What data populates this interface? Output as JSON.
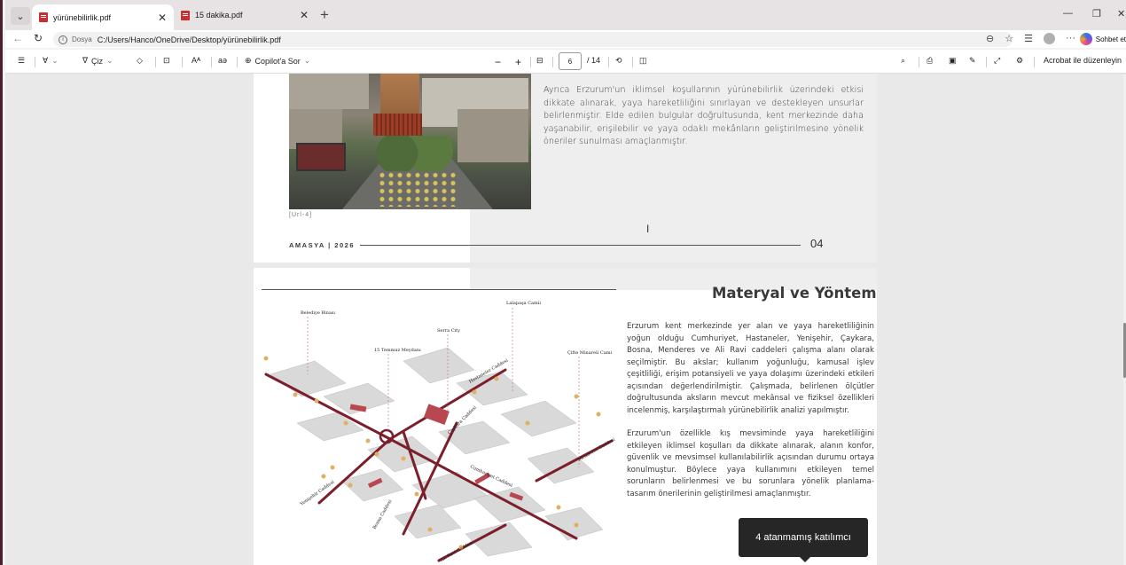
{
  "tabs": [
    {
      "title": "yürünebilirlik.pdf",
      "active": true
    },
    {
      "title": "15 dakika.pdf",
      "active": false
    }
  ],
  "address": {
    "protocol_label": "Dosya",
    "url": "C:/Users/Hanco/OneDrive/Desktop/yürünebilirlik.pdf",
    "copilot_label": "Sohbet et"
  },
  "pdf_toolbar": {
    "draw_label": "Çiz",
    "copilot_label": "Copilot'a Sor",
    "current_page": "6",
    "total_pages": "/ 14",
    "acrobat_label": "Acrobat ile düzenleyin"
  },
  "page1": {
    "body": "Ayrıca Erzurum'un iklimsel koşullarının yürünebilirlik üzerindeki etkisi dikkate alınarak, yaya hareketliliğini sınırlayan ve destekleyen unsurlar belirlenmiştir. Elde edilen bulgular doğrultusunda, kent merkezinde daha yaşanabilir, erişilebilir ve yaya odaklı mekânların geliştirilmesine yönelik öneriler sunulması amaçlanmıştır.",
    "caption": "[Url-4]",
    "footer_left": "AMASYA | 2026",
    "footer_num": "04"
  },
  "page2": {
    "title": "Materyal ve Yöntem",
    "para1": "Erzurum kent merkezinde yer alan ve yaya hareketliliğinin yoğun olduğu Cumhuriyet, Hastaneler, Yenişehir, Çaykara, Bosna, Menderes ve Ali Ravi caddeleri çalışma alanı olarak seçilmiştir. Bu akslar; kullanım yoğunluğu, kamusal işlev çeşitliliği, erişim potansiyeli ve yaya dolaşımı üzerindeki etkileri açısından değerlendirilmiştir. Çalışmada, belirlenen ölçütler doğrultusunda aksların mevcut mekânsal ve fiziksel özellikleri incelenmiş, karşılaştırmalı yürünebilirlik analizi yapılmıştır.",
    "para2": "Erzurum'un özellikle kış mevsiminde yaya hareketliliğini etkileyen iklimsel koşulları da dikkate alınarak, alanın konfor, güvenlik ve mevsimsel kullanılabilirlik açısından durumu ortaya konulmuştur. Böylece yaya kullanımını etkileyen temel sorunların belirlenmesi ve bu sorunlara yönelik planlama-tasarım önerilerinin geliştirilmesi amaçlanmıştır.",
    "map_labels": {
      "belediye": "Belediye Binası",
      "lalapasa": "Lalapaşa Camii",
      "serra": "Serra City",
      "temmuz": "15 Temmuz Meydanı",
      "cifte": "Çifte Minareli Cami",
      "hastaneler": "Hastaneler Caddesi",
      "caykara": "Çaykara Caddesi",
      "cumhuriyet": "Cumhuriyet Caddesi",
      "menderes": "Menderes Caddesi",
      "yenisehir": "Yenişehir Caddesi",
      "bosna": "Bosna Caddesi",
      "aliravi": "Ali Ravi Caddesi"
    }
  },
  "tooltip": "4 atanmamış katılımcı",
  "colors": {
    "accent_street": "#7a1f2b",
    "tab_pdf": "#c63030"
  }
}
